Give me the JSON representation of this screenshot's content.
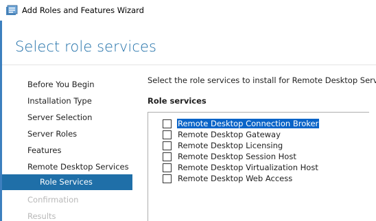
{
  "window": {
    "title": "Add Roles and Features Wizard",
    "icon": "server-manager-icon"
  },
  "header": {
    "title": "Select role services"
  },
  "nav": {
    "items": [
      {
        "label": "Before You Begin",
        "state": "normal"
      },
      {
        "label": "Installation Type",
        "state": "normal"
      },
      {
        "label": "Server Selection",
        "state": "normal"
      },
      {
        "label": "Server Roles",
        "state": "normal"
      },
      {
        "label": "Features",
        "state": "normal"
      },
      {
        "label": "Remote Desktop Services",
        "state": "normal"
      },
      {
        "label": "Role Services",
        "state": "active"
      },
      {
        "label": "Confirmation",
        "state": "disabled"
      },
      {
        "label": "Results",
        "state": "disabled"
      }
    ]
  },
  "content": {
    "instruction": "Select the role services to install for Remote Desktop Services",
    "section_label": "Role services",
    "role_services": [
      {
        "label": "Remote Desktop Connection Broker",
        "checked": false,
        "selected": true
      },
      {
        "label": "Remote Desktop Gateway",
        "checked": false,
        "selected": false
      },
      {
        "label": "Remote Desktop Licensing",
        "checked": false,
        "selected": false
      },
      {
        "label": "Remote Desktop Session Host",
        "checked": false,
        "selected": false
      },
      {
        "label": "Remote Desktop Virtualization Host",
        "checked": false,
        "selected": false
      },
      {
        "label": "Remote Desktop Web Access",
        "checked": false,
        "selected": false
      }
    ]
  },
  "colors": {
    "accent": "#1f6fa8",
    "selection": "#0a64c8",
    "disabled_text": "#b8b8b8"
  }
}
